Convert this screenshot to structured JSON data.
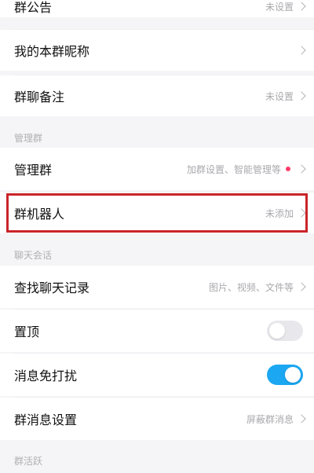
{
  "rows": {
    "announcement": {
      "label": "群公告",
      "value": "未设置"
    },
    "my_nickname": {
      "label": "我的本群昵称"
    },
    "remark": {
      "label": "群聊备注",
      "value": "未设置"
    },
    "manage_group": {
      "label": "管理群",
      "value": "加群设置、智能管理等"
    },
    "group_robot": {
      "label": "群机器人",
      "value": "未添加"
    },
    "find_history": {
      "label": "查找聊天记录",
      "value": "图片、视频、文件等"
    },
    "pin_top": {
      "label": "置顶",
      "toggle": "off"
    },
    "do_not_disturb": {
      "label": "消息免打扰",
      "toggle": "on"
    },
    "message_settings": {
      "label": "群消息设置",
      "value": "屏蔽群消息"
    }
  },
  "sections": {
    "manage": "管理群",
    "chat": "聊天会话",
    "activity": "群活跃"
  },
  "colors": {
    "accent_toggle": "#1ba7f2",
    "highlight_border": "#c9252a",
    "badge_dot": "#ff3b6b"
  }
}
